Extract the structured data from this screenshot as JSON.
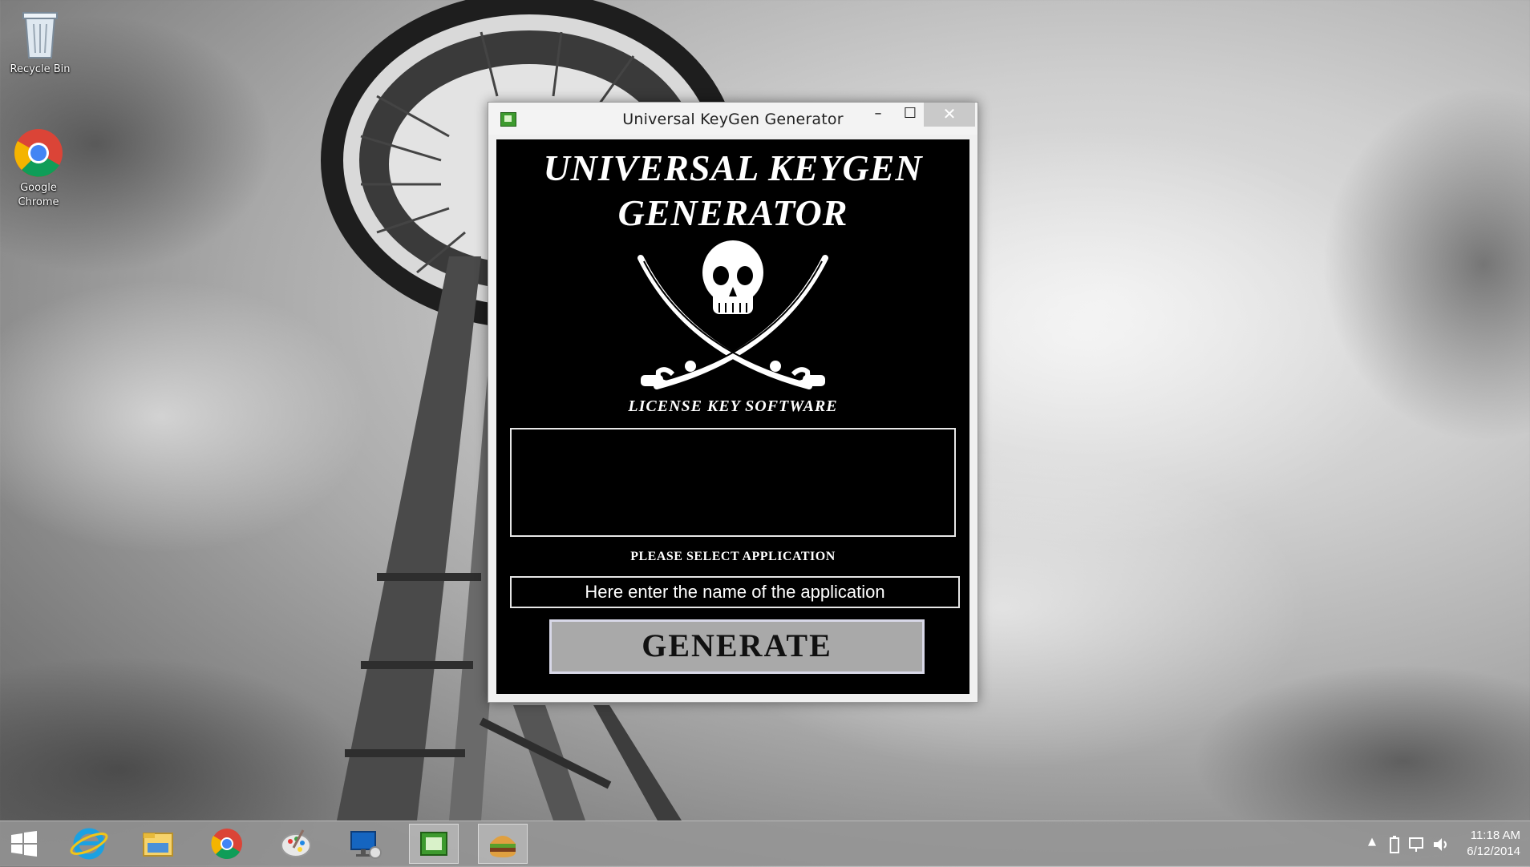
{
  "desktop": {
    "icons": [
      {
        "label": "Recycle Bin",
        "icon": "recycle-bin-icon"
      },
      {
        "label": "Google Chrome",
        "icon": "chrome-icon"
      }
    ]
  },
  "window": {
    "title": "Universal KeyGen Generator",
    "icon": "keygen-app-icon",
    "controls": {
      "minimize": "–",
      "maximize": "☐",
      "close": "✕"
    },
    "heading_line1": "UNIVERSAL KEYGEN",
    "heading_line2": "GENERATOR",
    "logo": "skull-crossed-swords-logo",
    "subtitle": "LICENSE KEY SOFTWARE",
    "key_output": "",
    "select_label": "PLEASE SELECT APPLICATION",
    "app_name_value": "Here enter the name of the application",
    "generate_label": "GENERATE"
  },
  "taskbar": {
    "apps": [
      "start-icon",
      "internet-explorer-icon",
      "file-explorer-icon",
      "chrome-icon",
      "paint-icon",
      "remote-desktop-icon",
      "keygen-app-icon",
      "burger-app-icon"
    ],
    "tray_icons": [
      "show-hidden-icon",
      "battery-icon",
      "network-icon",
      "volume-icon"
    ],
    "time": "11:18 AM",
    "date": "6/12/2014"
  },
  "colors": {
    "window_client": "#000000",
    "generate_button": "#a9a9a9",
    "close_button": "#c9c9c9"
  }
}
